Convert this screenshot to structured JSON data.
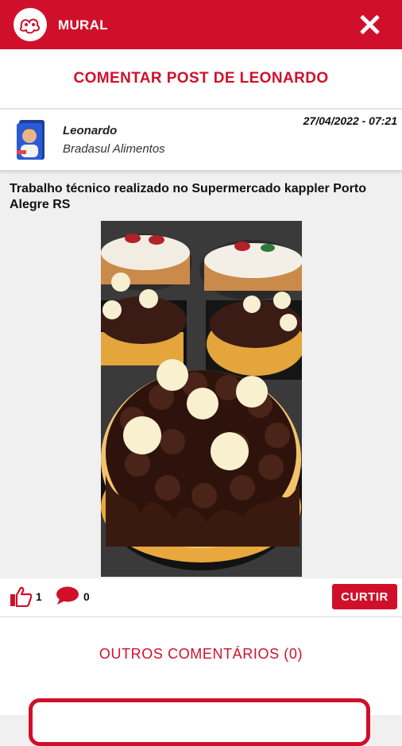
{
  "header": {
    "title": "MURAL"
  },
  "page": {
    "heading": "COMENTAR POST DE LEONARDO"
  },
  "post": {
    "author": "Leonardo",
    "company": "Bradasul Alimentos",
    "date": "27/04/2022 - 07:21",
    "text": "Trabalho técnico realizado no Supermercado kappler Porto Alegre RS"
  },
  "stats": {
    "likes": "1",
    "comments": "0",
    "like_button": "CURTIR"
  },
  "others": {
    "title": "OUTROS COMENTÁRIOS (0)"
  },
  "colors": {
    "brand": "#d0102b",
    "background": "#f0f0f0"
  }
}
